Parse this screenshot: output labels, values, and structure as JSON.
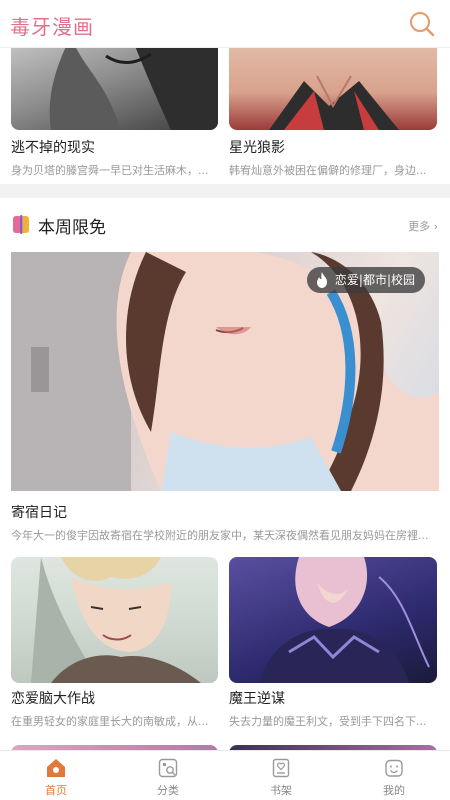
{
  "app": {
    "title": "毒牙漫画"
  },
  "top_row": [
    {
      "title": "逃不掉的现实",
      "desc": "身为贝塔的滕宫舜一早已对生活麻木，..."
    },
    {
      "title": "星光狼影",
      "desc": "韩宥灿意外被困在偏僻的修理厂，身边..."
    }
  ],
  "section": {
    "title": "本周限免",
    "more": "更多 ›",
    "featured": {
      "tag": "恋爱|都市|校园",
      "title": "寄宿日记",
      "desc": "今年大一的俊宇因故寄宿在学校附近的朋友家中，某天深夜偶然看见朋友妈妈在房裡..."
    },
    "grid": [
      {
        "title": "恋爱脑大作战",
        "desc": "在重男轻女的家庭里长大的南敏成，从..."
      },
      {
        "title": "魔王逆谋",
        "desc": "失去力量的魔王利文，受到手下四名下..."
      }
    ]
  },
  "tabs": [
    {
      "label": "首页",
      "icon": "home-icon",
      "active": true
    },
    {
      "label": "分类",
      "icon": "category-icon",
      "active": false
    },
    {
      "label": "书架",
      "icon": "bookshelf-icon",
      "active": false
    },
    {
      "label": "我的",
      "icon": "profile-icon",
      "active": false
    }
  ],
  "colors": {
    "brand": "#e0718a",
    "active_tab": "#e07a3c"
  }
}
